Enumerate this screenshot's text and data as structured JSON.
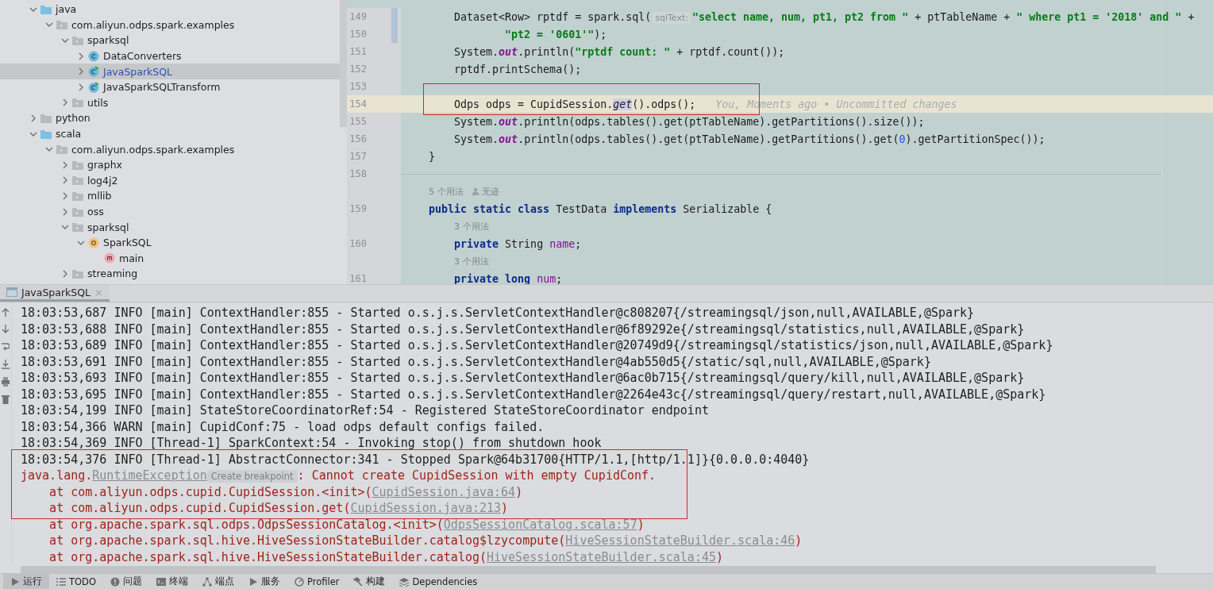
{
  "project_tree": [
    {
      "label": "java",
      "kind": "source_root",
      "expanded": true,
      "selected": false,
      "children": [
        {
          "label": "com.aliyun.odps.spark.examples",
          "kind": "package",
          "expanded": true,
          "selected": false,
          "children": [
            {
              "label": "sparksql",
              "kind": "package",
              "expanded": true,
              "selected": false,
              "children": [
                {
                  "label": "DataConverters",
                  "kind": "class",
                  "expanded": false,
                  "selected": false
                },
                {
                  "label": "JavaSparkSQL",
                  "kind": "runnable_class",
                  "expanded": false,
                  "selected": true
                },
                {
                  "label": "JavaSparkSQLTransform",
                  "kind": "runnable_class",
                  "expanded": false,
                  "selected": false
                }
              ]
            },
            {
              "label": "utils",
              "kind": "package",
              "expanded": false,
              "selected": false
            }
          ]
        }
      ]
    },
    {
      "label": "python",
      "kind": "folder",
      "expanded": false,
      "selected": false
    },
    {
      "label": "scala",
      "kind": "source_root",
      "expanded": true,
      "selected": false,
      "children": [
        {
          "label": "com.aliyun.odps.spark.examples",
          "kind": "package",
          "expanded": true,
          "selected": false,
          "children": [
            {
              "label": "graphx",
              "kind": "package",
              "expanded": false,
              "selected": false
            },
            {
              "label": "log4j2",
              "kind": "package",
              "expanded": false,
              "selected": false
            },
            {
              "label": "mllib",
              "kind": "package",
              "expanded": false,
              "selected": false
            },
            {
              "label": "oss",
              "kind": "package",
              "expanded": false,
              "selected": false
            },
            {
              "label": "sparksql",
              "kind": "package",
              "expanded": true,
              "selected": false,
              "children": [
                {
                  "label": "SparkSQL",
                  "kind": "object",
                  "expanded": true,
                  "selected": false,
                  "children": [
                    {
                      "label": "main",
                      "kind": "method",
                      "selected": false
                    }
                  ]
                }
              ]
            },
            {
              "label": "streaming",
              "kind": "package",
              "expanded": false,
              "selected": false
            }
          ]
        }
      ]
    }
  ],
  "editor": {
    "rows": [
      {
        "kind": "line",
        "number": "149",
        "changed": true,
        "current": false,
        "segments": [
          {
            "kind": "plain",
            "text": "        Dataset<Row> rptdf = spark.sql("
          },
          {
            "kind": "hint",
            "text": "sqlText:"
          },
          {
            "kind": "string",
            "text": "\"select name, num, pt1, pt2 from \""
          },
          {
            "kind": "plain",
            "text": " + ptTableName + "
          },
          {
            "kind": "string",
            "text": "\" where pt1 = '2018' and \""
          },
          {
            "kind": "plain",
            "text": " +"
          }
        ]
      },
      {
        "kind": "line",
        "number": "150",
        "changed": true,
        "current": false,
        "segments": [
          {
            "kind": "string",
            "text": "                \"pt2 = '0601'\""
          },
          {
            "kind": "plain",
            "text": ");"
          }
        ]
      },
      {
        "kind": "line",
        "number": "151",
        "changed": false,
        "current": false,
        "segments": [
          {
            "kind": "plain",
            "text": "        System."
          },
          {
            "kind": "static_field",
            "text": "out"
          },
          {
            "kind": "plain",
            "text": ".println("
          },
          {
            "kind": "string",
            "text": "\"rptdf count: \""
          },
          {
            "kind": "plain",
            "text": " + rptdf.count());"
          }
        ]
      },
      {
        "kind": "line",
        "number": "152",
        "changed": false,
        "current": false,
        "segments": [
          {
            "kind": "plain",
            "text": "        rptdf.printSchema();"
          }
        ]
      },
      {
        "kind": "line",
        "number": "153",
        "changed": false,
        "current": false,
        "segments": []
      },
      {
        "kind": "line",
        "number": "154",
        "changed": false,
        "current": true,
        "segments": [
          {
            "kind": "plain",
            "text": "        Odps odps = CupidSession."
          },
          {
            "kind": "static_method",
            "text": "get"
          },
          {
            "kind": "plain",
            "text": "().odps();"
          },
          {
            "kind": "blame",
            "text": "You, Moments ago • Uncommitted changes"
          }
        ]
      },
      {
        "kind": "line",
        "number": "155",
        "changed": false,
        "current": false,
        "segments": [
          {
            "kind": "plain",
            "text": "        System."
          },
          {
            "kind": "static_field",
            "text": "out"
          },
          {
            "kind": "plain",
            "text": ".println(odps.tables().get(ptTableName).getPartitions().size());"
          }
        ]
      },
      {
        "kind": "line",
        "number": "156",
        "changed": false,
        "current": false,
        "segments": [
          {
            "kind": "plain",
            "text": "        System."
          },
          {
            "kind": "static_field",
            "text": "out"
          },
          {
            "kind": "plain",
            "text": ".println(odps.tables().get(ptTableName).getPartitions().get("
          },
          {
            "kind": "number",
            "text": "0"
          },
          {
            "kind": "plain",
            "text": ").getPartitionSpec());"
          }
        ]
      },
      {
        "kind": "line",
        "number": "157",
        "changed": false,
        "current": false,
        "segments": [
          {
            "kind": "plain",
            "text": "    }"
          }
        ]
      },
      {
        "kind": "line",
        "number": "158",
        "changed": false,
        "current": false,
        "segments": []
      },
      {
        "kind": "usages",
        "indent": "    ",
        "usages": "5 个用法",
        "author": "无迹"
      },
      {
        "kind": "line",
        "number": "159",
        "changed": false,
        "current": false,
        "segments": [
          {
            "kind": "keyword",
            "text": "    public static class"
          },
          {
            "kind": "plain",
            "text": " TestData "
          },
          {
            "kind": "keyword",
            "text": "implements"
          },
          {
            "kind": "plain",
            "text": " Serializable {"
          }
        ]
      },
      {
        "kind": "usages",
        "indent": "        ",
        "usages": "3 个用法"
      },
      {
        "kind": "line",
        "number": "160",
        "changed": false,
        "current": false,
        "segments": [
          {
            "kind": "keyword",
            "text": "        private"
          },
          {
            "kind": "plain",
            "text": " String "
          },
          {
            "kind": "field",
            "text": "name"
          },
          {
            "kind": "plain",
            "text": ";"
          }
        ]
      },
      {
        "kind": "usages",
        "indent": "        ",
        "usages": "3 个用法"
      },
      {
        "kind": "line",
        "number": "161",
        "changed": false,
        "current": false,
        "segments": [
          {
            "kind": "keyword",
            "text": "        private long "
          },
          {
            "kind": "field",
            "text": "num"
          },
          {
            "kind": "plain",
            "text": ";"
          }
        ]
      }
    ]
  },
  "run_tabs": [
    {
      "label": "JavaSparkSQL",
      "close": "×",
      "selected": true
    }
  ],
  "console": {
    "lines": [
      {
        "kind": "log",
        "segments": [
          {
            "kind": "plain",
            "text": "18:03:53,687 INFO [main] ContextHandler:855 - Started o.s.j.s.ServletContextHandler@c808207{/streamingsql/json,null,AVAILABLE,@Spark}"
          }
        ]
      },
      {
        "kind": "log",
        "segments": [
          {
            "kind": "plain",
            "text": "18:03:53,688 INFO [main] ContextHandler:855 - Started o.s.j.s.ServletContextHandler@6f89292e{/streamingsql/statistics,null,AVAILABLE,@Spark}"
          }
        ]
      },
      {
        "kind": "log",
        "segments": [
          {
            "kind": "plain",
            "text": "18:03:53,689 INFO [main] ContextHandler:855 - Started o.s.j.s.ServletContextHandler@20749d9{/streamingsql/statistics/json,null,AVAILABLE,@Spark}"
          }
        ]
      },
      {
        "kind": "log",
        "segments": [
          {
            "kind": "plain",
            "text": "18:03:53,691 INFO [main] ContextHandler:855 - Started o.s.j.s.ServletContextHandler@4ab550d5{/static/sql,null,AVAILABLE,@Spark}"
          }
        ]
      },
      {
        "kind": "log",
        "segments": [
          {
            "kind": "plain",
            "text": "18:03:53,693 INFO [main] ContextHandler:855 - Started o.s.j.s.ServletContextHandler@6ac0b715{/streamingsql/query/kill,null,AVAILABLE,@Spark}"
          }
        ]
      },
      {
        "kind": "log",
        "segments": [
          {
            "kind": "plain",
            "text": "18:03:53,695 INFO [main] ContextHandler:855 - Started o.s.j.s.ServletContextHandler@2264e43c{/streamingsql/query/restart,null,AVAILABLE,@Spark}"
          }
        ]
      },
      {
        "kind": "log",
        "segments": [
          {
            "kind": "plain",
            "text": "18:03:54,199 INFO [main] StateStoreCoordinatorRef:54 - Registered StateStoreCoordinator endpoint"
          }
        ]
      },
      {
        "kind": "log",
        "segments": [
          {
            "kind": "plain",
            "text": "18:03:54,366 WARN [main] CupidConf:75 - load odps default configs failed."
          }
        ]
      },
      {
        "kind": "log",
        "segments": [
          {
            "kind": "plain",
            "text": "18:03:54,369 INFO [Thread-1] SparkContext:54 - Invoking stop() from shutdown hook"
          }
        ]
      },
      {
        "kind": "log",
        "segments": [
          {
            "kind": "plain",
            "text": "18:03:54,376 INFO [Thread-1] AbstractConnector:341 - Stopped Spark@64b31700{HTTP/1.1,[http/1.1]}{0.0.0.0:4040}"
          }
        ]
      },
      {
        "kind": "error",
        "segments": [
          {
            "kind": "plain",
            "text": "java.lang."
          },
          {
            "kind": "link",
            "text": "RuntimeException"
          },
          {
            "kind": "hint",
            "text": "Create breakpoint"
          },
          {
            "kind": "plain",
            "text": ": Cannot create CupidSession with empty CupidConf."
          }
        ]
      },
      {
        "kind": "error",
        "segments": [
          {
            "kind": "plain",
            "text": "    at com.aliyun.odps.cupid.CupidSession.<init>("
          },
          {
            "kind": "link",
            "text": "CupidSession.java:64"
          },
          {
            "kind": "plain",
            "text": ")"
          }
        ]
      },
      {
        "kind": "error",
        "segments": [
          {
            "kind": "plain",
            "text": "    at com.aliyun.odps.cupid.CupidSession.get("
          },
          {
            "kind": "link",
            "text": "CupidSession.java:213"
          },
          {
            "kind": "plain",
            "text": ")"
          }
        ]
      },
      {
        "kind": "error",
        "segments": [
          {
            "kind": "plain",
            "text": "    at org.apache.spark.sql.odps.OdpsSessionCatalog.<init>("
          },
          {
            "kind": "link",
            "text": "OdpsSessionCatalog.scala:57"
          },
          {
            "kind": "plain",
            "text": ")"
          }
        ]
      },
      {
        "kind": "error",
        "segments": [
          {
            "kind": "plain",
            "text": "    at org.apache.spark.sql.hive.HiveSessionStateBuilder.catalog$lzycompute("
          },
          {
            "kind": "link",
            "text": "HiveSessionStateBuilder.scala:46"
          },
          {
            "kind": "plain",
            "text": ")"
          }
        ]
      },
      {
        "kind": "error",
        "segments": [
          {
            "kind": "plain",
            "text": "    at org.apache.spark.sql.hive.HiveSessionStateBuilder.catalog("
          },
          {
            "kind": "link",
            "text": "HiveSessionStateBuilder.scala:45"
          },
          {
            "kind": "plain",
            "text": ")"
          }
        ]
      }
    ]
  },
  "tool_windows": [
    {
      "label": "运行",
      "selected": true
    },
    {
      "label": "TODO",
      "selected": false
    },
    {
      "label": "问题",
      "selected": false
    },
    {
      "label": "终端",
      "selected": false
    },
    {
      "label": "端点",
      "selected": false
    },
    {
      "label": "服务",
      "selected": false
    },
    {
      "label": "Profiler",
      "selected": false
    },
    {
      "label": "构建",
      "selected": false
    },
    {
      "label": "Dependencies",
      "selected": false
    }
  ]
}
